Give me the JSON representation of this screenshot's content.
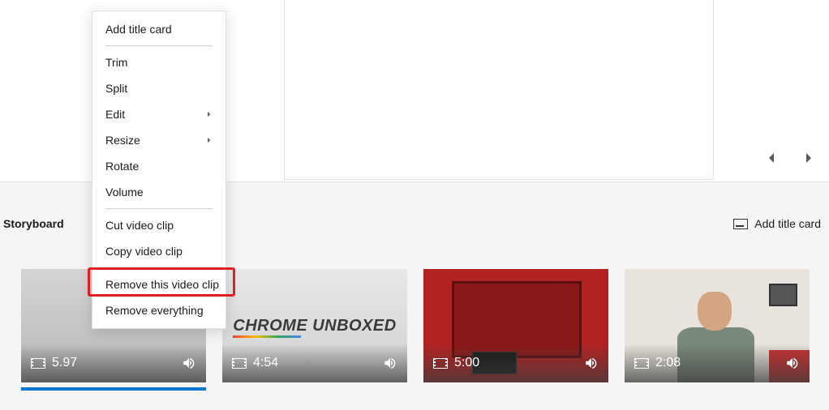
{
  "preview": {
    "nav_prev": "Previous frame",
    "nav_next": "Next frame"
  },
  "storyboard": {
    "label": "Storyboard",
    "add_title_card": "Add title card"
  },
  "clips": [
    {
      "duration": "5.97",
      "thumb_text": ""
    },
    {
      "duration": "4:54",
      "thumb_text": "CHROME UNBOXED"
    },
    {
      "duration": "5:00",
      "thumb_text": ""
    },
    {
      "duration": "2:08",
      "thumb_text": ""
    }
  ],
  "context_menu": {
    "items": [
      {
        "label": "Add title card",
        "submenu": false
      },
      {
        "separator": true
      },
      {
        "label": "Trim",
        "submenu": false
      },
      {
        "label": "Split",
        "submenu": false
      },
      {
        "label": "Edit",
        "submenu": true
      },
      {
        "label": "Resize",
        "submenu": true
      },
      {
        "label": "Rotate",
        "submenu": false
      },
      {
        "label": "Volume",
        "submenu": false
      },
      {
        "separator": true
      },
      {
        "label": "Cut video clip",
        "submenu": false
      },
      {
        "label": "Copy video clip",
        "submenu": false
      },
      {
        "separator": true
      },
      {
        "label": "Remove this video clip",
        "submenu": false
      },
      {
        "label": "Remove everything",
        "submenu": false
      }
    ]
  }
}
